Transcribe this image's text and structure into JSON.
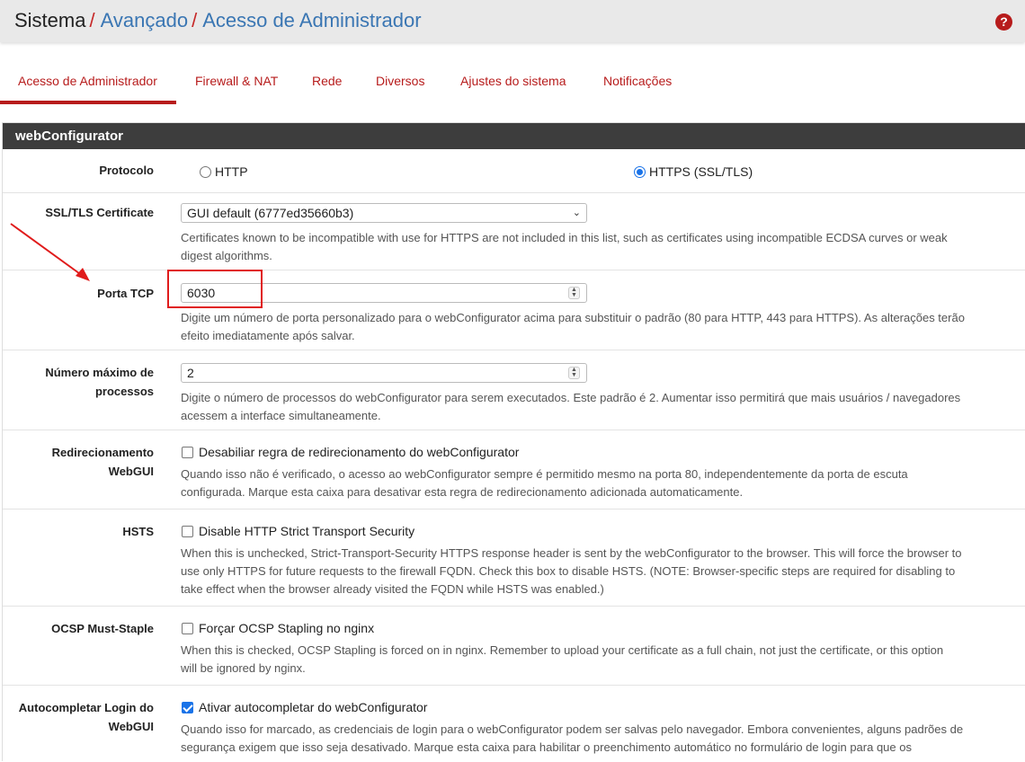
{
  "breadcrumb": {
    "level1": "Sistema",
    "sep": "/",
    "level2": "Avançado",
    "level3": "Acesso de Administrador"
  },
  "help_icon": "?",
  "tabs": [
    {
      "label": "Acesso de Administrador",
      "active": true
    },
    {
      "label": "Firewall & NAT"
    },
    {
      "label": "Rede"
    },
    {
      "label": "Diversos"
    },
    {
      "label": "Ajustes do sistema"
    },
    {
      "label": "Notificações"
    }
  ],
  "panel": {
    "title": "webConfigurator",
    "protocol": {
      "label": "Protocolo",
      "options": [
        "HTTP",
        "HTTPS (SSL/TLS)"
      ],
      "selected": "HTTPS (SSL/TLS)"
    },
    "ssl_cert": {
      "label": "SSL/TLS Certificate",
      "value": "GUI default (6777ed35660b3)",
      "help1": "Certificates known to be incompatible with use for HTTPS are not included in this list, such as certificates using incompatible ECDSA curves or weak",
      "help2": "digest algorithms."
    },
    "tcp_port": {
      "label": "Porta TCP",
      "value": "6030",
      "help1": "Digite um número de porta personalizado para o webConfigurator acima para substituir o padrão (80 para HTTP, 443 para HTTPS). As alterações terão",
      "help2": "efeito imediatamente após salvar."
    },
    "max_processes": {
      "label1": "Número máximo de",
      "label2": "processos",
      "value": "2",
      "help1": "Digite o número de processos do webConfigurator para serem executados. Este padrão é 2. Aumentar isso permitirá que mais usuários / navegadores",
      "help2": "acessem a interface simultaneamente."
    },
    "redirect": {
      "label1": "Redirecionamento",
      "label2": "WebGUI",
      "checkbox_label": "Desabiliar regra de redirecionamento do webConfigurator",
      "checked": false,
      "help1": "Quando isso não é verificado, o acesso ao webConfigurator sempre é permitido mesmo na porta 80, independentemente da porta de escuta",
      "help2": "configurada. Marque esta caixa para desativar esta regra de redirecionamento adicionada automaticamente."
    },
    "hsts": {
      "label": "HSTS",
      "checkbox_label": "Disable HTTP Strict Transport Security",
      "checked": false,
      "help1": "When this is unchecked, Strict-Transport-Security HTTPS response header is sent by the webConfigurator to the browser. This will force the browser to",
      "help2": "use only HTTPS for future requests to the firewall FQDN. Check this box to disable HSTS. (NOTE: Browser-specific steps are required for disabling to",
      "help3": "take effect when the browser already visited the FQDN while HSTS was enabled.)"
    },
    "ocsp": {
      "label": "OCSP Must-Staple",
      "checkbox_label": "Forçar OCSP Stapling no nginx",
      "checked": false,
      "help1": "When this is checked, OCSP Stapling is forced on in nginx. Remember to upload your certificate as a full chain, not just the certificate, or this option",
      "help2": "will be ignored by nginx."
    },
    "autocomplete": {
      "label1": "Autocompletar Login do",
      "label2": "WebGUI",
      "checkbox_label": "Ativar autocompletar do webConfigurator",
      "checked": true,
      "help1": "Quando isso for marcado, as credenciais de login para o webConfigurator podem ser salvas pelo navegador. Embora convenientes, alguns padrões de",
      "help2": "segurança exigem que isso seja desativado. Marque esta caixa para habilitar o preenchimento automático no formulário de login para que os"
    }
  },
  "colors": {
    "accent_red": "#b71c1c",
    "link_blue": "#3a76b3",
    "panel_header": "#3d3d3d",
    "annotation_red": "#e01b1b",
    "check_blue": "#1a73e8"
  }
}
